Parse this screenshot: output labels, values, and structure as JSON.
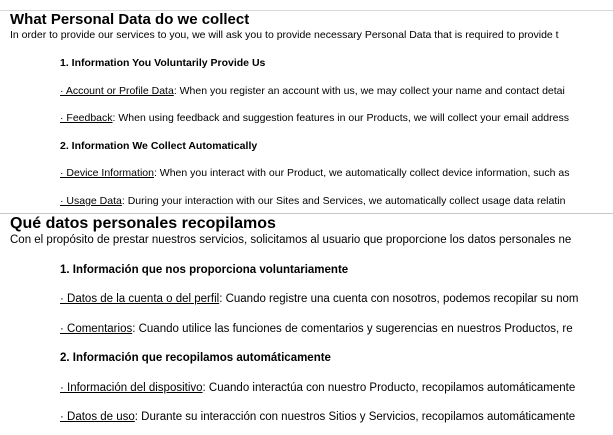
{
  "english": {
    "title": "What Personal Data do we collect",
    "intro": "In order to provide our services to you, we will ask you to provide necessary Personal Data that is required to provide t",
    "section1_heading": "1. Information You Voluntarily Provide Us",
    "items": [
      {
        "link": "· Account or Profile Data",
        "text": ": When you register an account with us, we may collect your name and contact detai"
      },
      {
        "link": "· Feedback",
        "text": ": When using feedback and suggestion features in our Products, we will collect your email address"
      },
      {
        "link": "· Device Information",
        "text": ": When you interact with our Product, we automatically collect device information, such as"
      },
      {
        "link": "· Usage Data",
        "text": ": During your interaction with our Sites and Services, we automatically collect usage data relatin"
      }
    ],
    "section2_heading": "2. Information We Collect Automatically"
  },
  "spanish": {
    "title": "Qué datos personales recopilamos",
    "intro": "Con el propósito de prestar nuestros servicios, solicitamos al usuario que proporcione los datos personales ne",
    "section1_heading": "1. Información que nos proporciona voluntariamente",
    "items": [
      {
        "link": "· Datos de la cuenta o del perfil",
        "text": ": Cuando registre una cuenta con nosotros, podemos recopilar su nom"
      },
      {
        "link": "· Comentarios",
        "text": ": Cuando utilice las funciones de comentarios y sugerencias en nuestros Productos, re"
      },
      {
        "link": "· Información del dispositivo",
        "text": ": Cuando interactúa con nuestro Producto, recopilamos automáticamente"
      },
      {
        "link": "· Datos de uso",
        "text": ": Durante su interacción con nuestros Sitios y Servicios, recopilamos automáticamente"
      }
    ],
    "section2_heading": "2. Información que recopilamos automáticamente"
  }
}
